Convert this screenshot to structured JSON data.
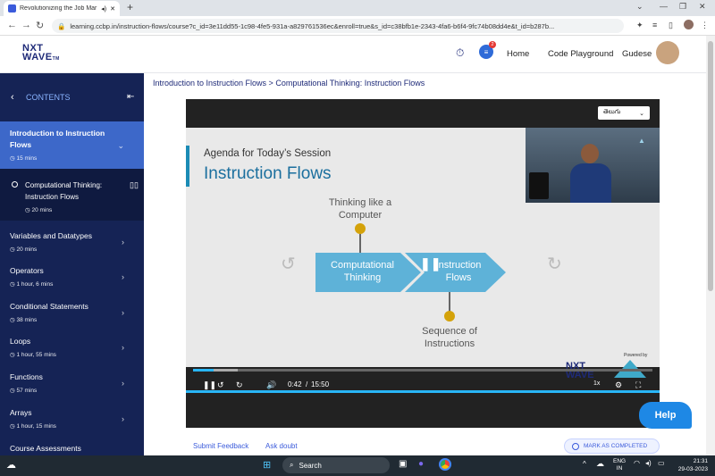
{
  "browser": {
    "tab_title": "Revolutionizing the Job Mar",
    "url": "learning.ccbp.in/instruction-flows/course?c_id=3e11dd55-1c98-4fe5-931a-a829761536ec&enroll=true&s_id=c38bfb1e-2343-4fa6-b6f4-9fc74b08dd4e&t_id=b287b..."
  },
  "header": {
    "logo_top": "NXT",
    "logo_bottom": "WAVE",
    "logo_tm": "TM",
    "badge_count": "2",
    "links": [
      "Home",
      "Code Playground"
    ],
    "user_name": "Gudese"
  },
  "sidebar": {
    "title": "CONTENTS",
    "items": [
      {
        "title": "Introduction to Instruction Flows",
        "meta": "15 mins"
      },
      {
        "title": "Computational Thinking: Instruction Flows",
        "meta": "20 mins"
      },
      {
        "title": "Variables and Datatypes",
        "meta": "20 mins"
      },
      {
        "title": "Operators",
        "meta": "1 hour, 6 mins"
      },
      {
        "title": "Conditional Statements",
        "meta": "38 mins"
      },
      {
        "title": "Loops",
        "meta": "1 hour, 55 mins"
      },
      {
        "title": "Functions",
        "meta": "57 mins"
      },
      {
        "title": "Arrays",
        "meta": "1 hour, 15 mins"
      },
      {
        "title": "Course Assessments",
        "meta": ""
      }
    ]
  },
  "main": {
    "breadcrumb": "Introduction to Instruction Flows > Computational Thinking: Instruction Flows",
    "language": "తెలుగు",
    "slide": {
      "subtitle": "Agenda for Today’s Session",
      "title": "Instruction Flows",
      "top_label": "Thinking like a Computer",
      "box1": "Computational Thinking",
      "box2": "Instruction Flows",
      "bottom_label": "Sequence of Instructions",
      "powered_by": "Powered by"
    },
    "player": {
      "current_time": "0:42",
      "separator": "/",
      "duration": "15:50",
      "speed": "1x",
      "progress": 0.044
    },
    "submit_feedback": "Submit Feedback",
    "ask_doubt": "Ask doubt",
    "mark_completed": "MARK AS COMPLETED",
    "help": "Help"
  },
  "taskbar": {
    "search": "Search",
    "lang_top": "ENG",
    "lang_bottom": "IN",
    "time": "21:31",
    "date": "29-03-2023"
  }
}
